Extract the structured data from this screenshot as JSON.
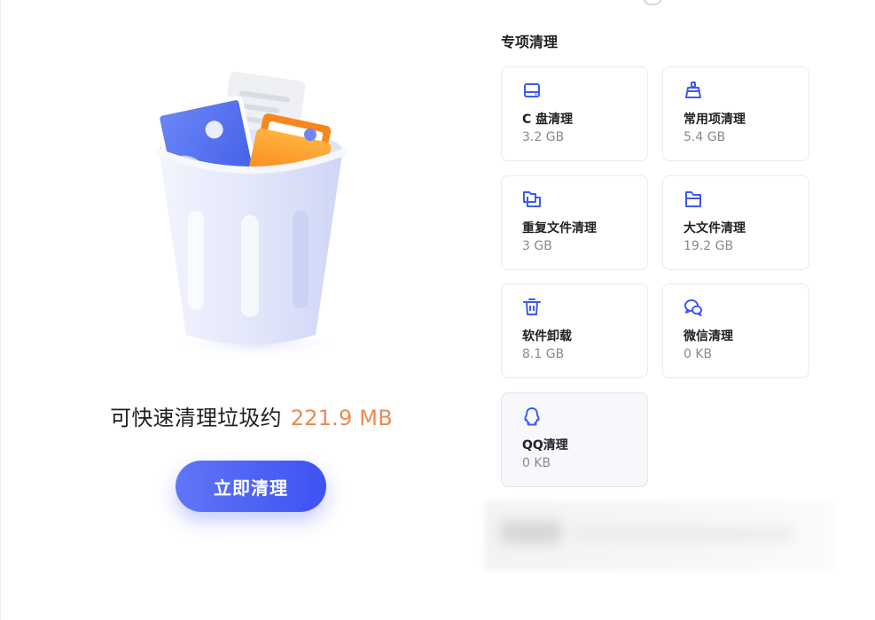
{
  "left_panel": {
    "summary_text": "可快速清理垃圾约",
    "summary_amount": "221.9 MB",
    "clean_button_label": "立即清理"
  },
  "right_panel": {
    "section_title": "专项清理",
    "items": [
      {
        "icon": "disk-icon",
        "label": "C 盘清理",
        "size": "3.2 GB"
      },
      {
        "icon": "broom-icon",
        "label": "常用项清理",
        "size": "5.4 GB"
      },
      {
        "icon": "duplicate-files-icon",
        "label": "重复文件清理",
        "size": "3 GB"
      },
      {
        "icon": "large-file-icon",
        "label": "大文件清理",
        "size": "19.2 GB"
      },
      {
        "icon": "trash-icon",
        "label": "软件卸载",
        "size": "8.1 GB"
      },
      {
        "icon": "wechat-icon",
        "label": "微信清理",
        "size": "0 KB"
      },
      {
        "icon": "qq-icon",
        "label": "QQ清理",
        "size": "0 KB"
      }
    ]
  },
  "colors": {
    "accent": "#3d52f3",
    "amount": "#f0874f",
    "icon": "#3d5af1"
  }
}
